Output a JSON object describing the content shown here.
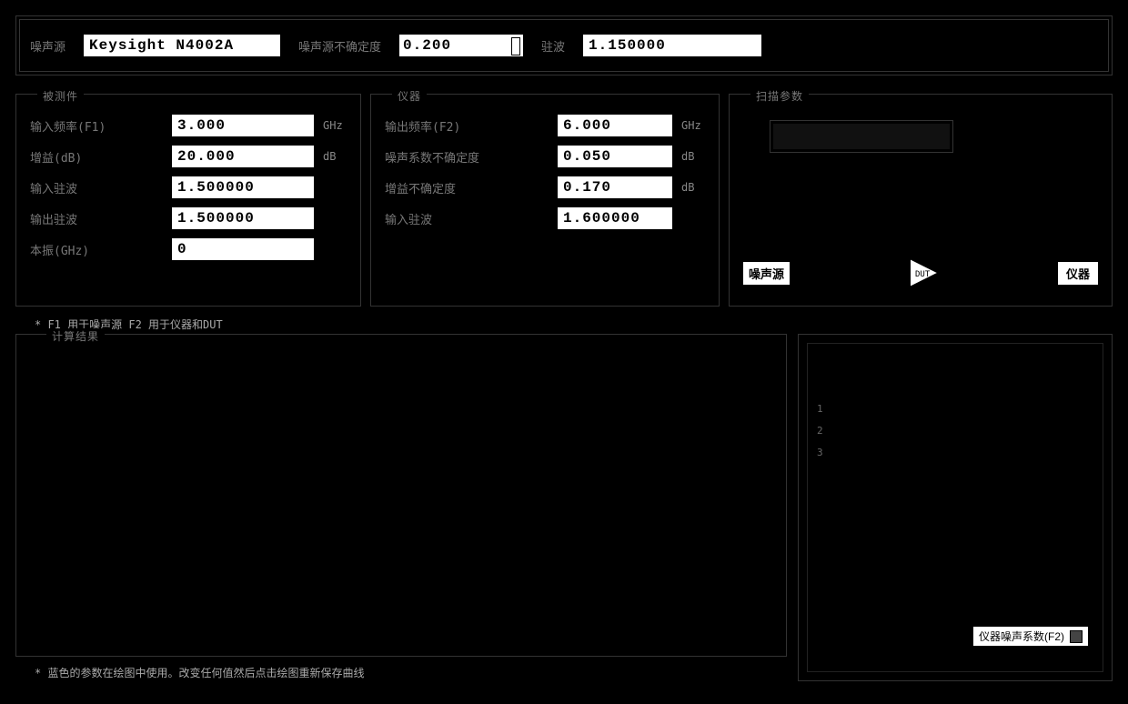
{
  "top": {
    "label_source": "噪声源",
    "model": "Keysight N4002A",
    "label_ns_unc": "噪声源不确定度",
    "ns_unc": "0.200",
    "label_vswr": "驻波",
    "vswr": "1.150000"
  },
  "left_group": {
    "title": "被测件",
    "rows": [
      {
        "label": "输入频率(F1)",
        "value": "3.000",
        "unit": "GHz"
      },
      {
        "label": "增益(dB)",
        "value": "20.000",
        "unit": "dB"
      },
      {
        "label": "输入驻波",
        "value": "1.500000",
        "unit": ""
      },
      {
        "label": "输出驻波",
        "value": "1.500000",
        "unit": ""
      },
      {
        "label": "本振(GHz)",
        "value": "0",
        "unit": ""
      }
    ]
  },
  "mid_group": {
    "title": "仪器",
    "rows": [
      {
        "label": "输出频率(F2)",
        "value": "6.000",
        "unit": "GHz"
      },
      {
        "label": "噪声系数不确定度",
        "value": "0.050",
        "unit": "dB"
      },
      {
        "label": "增益不确定度",
        "value": "0.170",
        "unit": "dB"
      },
      {
        "label": "输入驻波",
        "value": "1.600000",
        "unit": ""
      }
    ]
  },
  "right_group": {
    "title": "扫描参数",
    "result_placeholder": "",
    "btn_source": "噪声源",
    "btn_instrument": "仪器",
    "amp_label": "DUT"
  },
  "note1": "* F1 用于噪声源  F2 用于仪器和DUT",
  "results_title": "计算结果",
  "note2": "* 蓝色的参数在绘图中使用。改变任何值然后点击绘图重新保存曲线",
  "scale": [
    "1",
    "2",
    "3"
  ],
  "legend": "仪器噪声系数(F2)"
}
